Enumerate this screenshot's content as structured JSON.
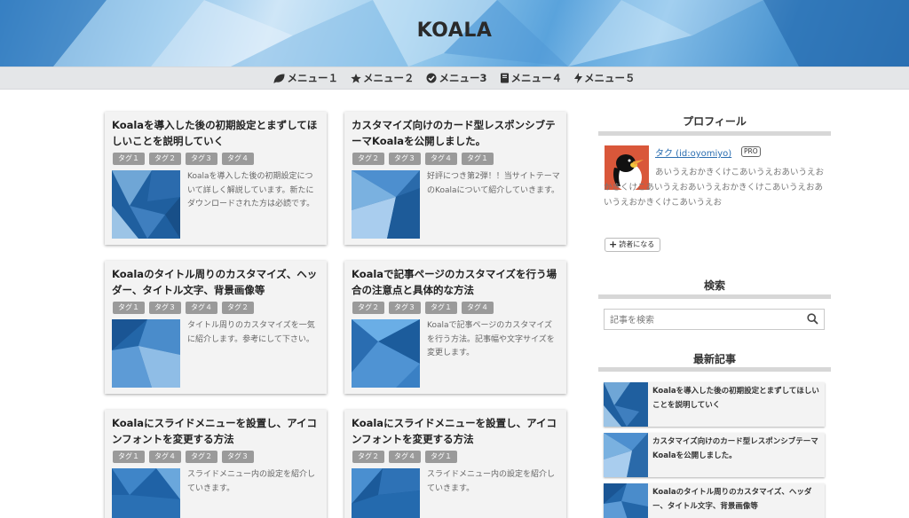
{
  "site": {
    "title": "KOALA"
  },
  "nav": [
    {
      "label": "メニュー１",
      "icon": "leaf-icon"
    },
    {
      "label": "メニュー２",
      "icon": "star-icon"
    },
    {
      "label": "メニュー3",
      "icon": "check-circle-icon"
    },
    {
      "label": "メニュー４",
      "icon": "book-icon"
    },
    {
      "label": "メニュー５",
      "icon": "bolt-icon"
    }
  ],
  "cards": [
    {
      "title": "Koalaを導入した後の初期設定とまずしてほしいことを説明していく",
      "tags": [
        "タグ１",
        "タグ２",
        "タグ３",
        "タグ４"
      ],
      "desc": "Koalaを導入した後の初期設定について詳しく解説しています。新たにダウンロードされた方は必読です。"
    },
    {
      "title": "カスタマイズ向けのカード型レスポンシブテーマKoalaを公開しました。",
      "tags": [
        "タグ２",
        "タグ３",
        "タグ４",
        "タグ１"
      ],
      "desc": "好評につき第2弾！！当サイトテーマのKoalaについて紹介していきます。"
    },
    {
      "title": "Koalaのタイトル周りのカスタマイズ、ヘッダー、タイトル文字、背景画像等",
      "tags": [
        "タグ１",
        "タグ３",
        "タグ４",
        "タグ２"
      ],
      "desc": "タイトル周りのカスタマイズを一気に紹介します。参考にして下さい。"
    },
    {
      "title": "Koalaで記事ページのカスタマイズを行う場合の注意点と具体的な方法",
      "tags": [
        "タグ２",
        "タグ３",
        "タグ１",
        "タグ４"
      ],
      "desc": "Koalaで記事ページのカスタマイズを行う方法。記事幅や文字サイズを変更します。"
    },
    {
      "title": "Koalaにスライドメニューを設置し、アイコンフォントを変更する方法",
      "tags": [
        "タグ１",
        "タグ４",
        "タグ２",
        "タグ３"
      ],
      "desc": "スライドメニュー内の設定を紹介していきます。"
    },
    {
      "title": "Koalaにスライドメニューを設置し、アイコンフォントを変更する方法",
      "tags": [
        "タグ２",
        "タグ４",
        "タグ１"
      ],
      "desc": "スライドメニュー内の設定を紹介していきます。"
    }
  ],
  "sidebar": {
    "profile": {
      "heading": "プロフィール",
      "name": "タク (id:oyomiyo)",
      "badge": "PRO",
      "bio": "あいうえおかきくけこあいうえおあいうえおかきくけこあいうえおあいうえおかきくけこあいうえおあいうえおかきくけこあいうえお",
      "reader_button": "読者になる"
    },
    "search": {
      "heading": "検索",
      "placeholder": "記事を検索"
    },
    "recent": {
      "heading": "最新記事",
      "items": [
        "Koalaを導入した後の初期設定とまずしてほしいことを説明していく",
        "カスタマイズ向けのカード型レスポンシブテーマKoalaを公開しました。",
        "Koalaのタイトル周りのカスタマイズ、ヘッダー、タイトル文字、背景画像等"
      ]
    }
  },
  "colors": {
    "nav_bg": "#e4e6e8",
    "tag_bg": "#9a9a9a",
    "card_bg": "#f3f3f3",
    "link": "#2a6db0"
  }
}
